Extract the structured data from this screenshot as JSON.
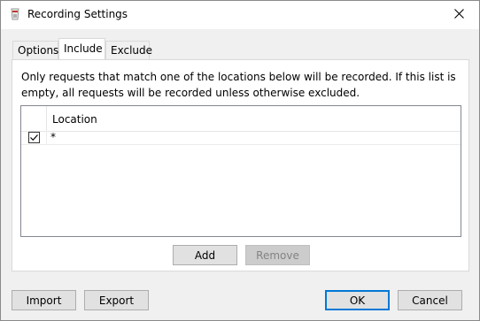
{
  "window": {
    "title": "Recording Settings"
  },
  "tabs": [
    {
      "label": "Options"
    },
    {
      "label": "Include"
    },
    {
      "label": "Exclude"
    }
  ],
  "include": {
    "description": "Only requests that match one of the locations below will be recorded. If this list is empty, all requests will be recorded unless otherwise excluded.",
    "column_header": "Location",
    "rows": [
      {
        "checked": true,
        "location": "*"
      }
    ],
    "add_label": "Add",
    "remove_label": "Remove"
  },
  "footer": {
    "import_label": "Import",
    "export_label": "Export",
    "ok_label": "OK",
    "cancel_label": "Cancel"
  },
  "colors": {
    "accent": "#0078d7"
  }
}
